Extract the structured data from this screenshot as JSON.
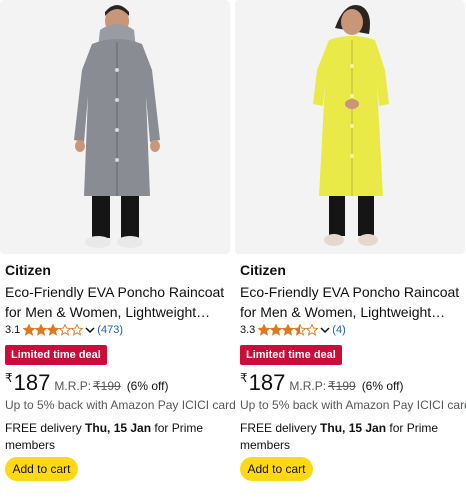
{
  "products": [
    {
      "brand": "Citizen",
      "title": "Eco-Friendly EVA Poncho Raincoat for Men & Women, Lightweight…",
      "rating": "3.1",
      "stars_filled": 3,
      "reviews": "(473)",
      "deal": "Limited time deal",
      "currency": "₹",
      "price": "187",
      "mrp_label": "M.R.P:",
      "mrp": "₹199",
      "discount": "(6% off)",
      "cashback": "Up to 5% back with Amazon Pay ICICI card",
      "delivery_prefix": "FREE delivery ",
      "delivery_date": "Thu, 15 Jan",
      "delivery_suffix": " for Prime members",
      "cart_label": "Add to cart",
      "coat_color": "#8a8c93"
    },
    {
      "brand": "Citizen",
      "title": "Eco-Friendly EVA Poncho Raincoat for Men & Women, Lightweight…",
      "rating": "3.3",
      "stars_filled": 3.5,
      "reviews": "(4)",
      "deal": "Limited time deal",
      "currency": "₹",
      "price": "187",
      "mrp_label": "M.R.P:",
      "mrp": "₹199",
      "discount": "(6% off)",
      "cashback": "Up to 5% back with Amazon Pay ICICI card",
      "delivery_prefix": "FREE delivery ",
      "delivery_date": "Thu, 15 Jan",
      "delivery_suffix": " for Prime members",
      "cart_label": "Add to cart",
      "coat_color": "#e9ea47"
    }
  ],
  "colors": {
    "deal_badge": "#cc0c39",
    "star": "#de7921",
    "link": "#2162a1",
    "button": "#ffd814"
  }
}
